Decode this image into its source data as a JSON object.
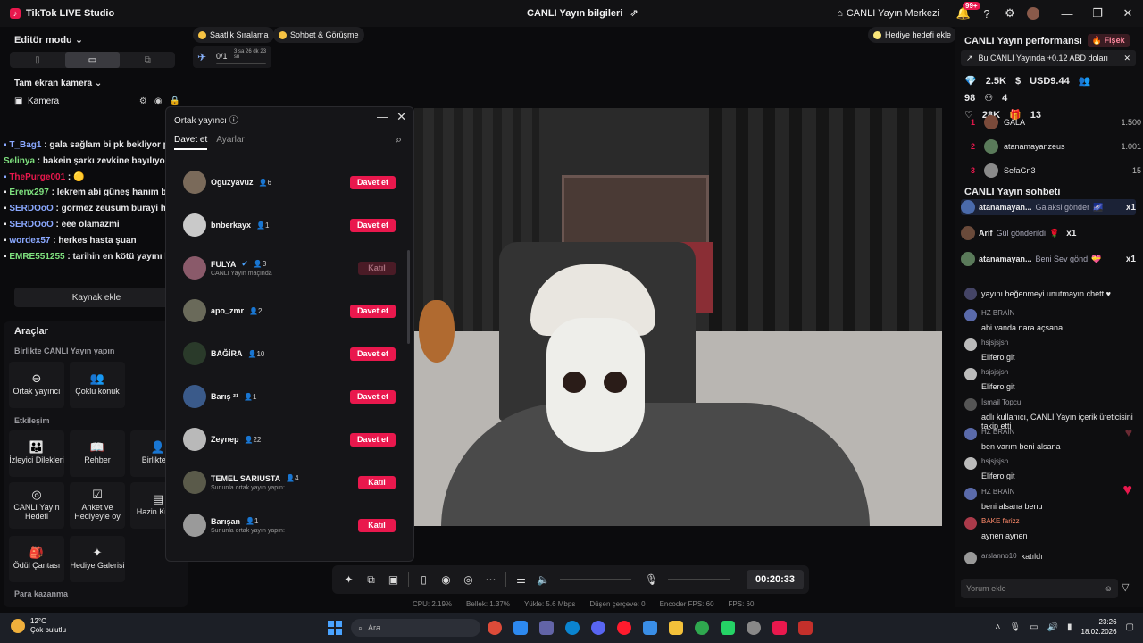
{
  "titlebar": {
    "app_name": "TikTok LIVE Studio",
    "center_title": "CANLI Yayın bilgileri",
    "live_center": "CANLI Yayın Merkezi",
    "notif_badge": "99+"
  },
  "left": {
    "editor_mode": "Editör modu",
    "camera_section": "Tam ekran kamera",
    "camera_label": "Kamera",
    "chat_lines": [
      {
        "user": "T_Bag1",
        "text": " : gala sağlam bi pk bekliyor pusuda",
        "color": "#8aa8ff"
      },
      {
        "user": "Selinya",
        "text": " : bakein şarkı zevkine bayılıyorum",
        "color": "#7ee07e"
      },
      {
        "user": "ThePurge001",
        "text": " : ",
        "color": "#e9184d"
      },
      {
        "user": "Erenx297",
        "text": " : lekrem abi güneş hanım bugün yayın açmıcak mı",
        "color": "#7ee07e"
      },
      {
        "user": "SERDOoO",
        "text": " : gormez zeusum burayi hu",
        "color": "#8aa8ff"
      },
      {
        "user": "SERDOoO",
        "text": " : eee olamazmi",
        "color": "#8aa8ff"
      },
      {
        "user": "wordex57",
        "text": " : herkes hasta şuan",
        "color": "#8aa8ff"
      },
      {
        "user": "EMRE551255",
        "text": " : tarihin en kötü yayını harbi",
        "color": "#7ee07e"
      }
    ],
    "add_source": "Kaynak ekle",
    "tools_title": "Araçlar",
    "together_title": "Birlikte CANLI Yayın yapın",
    "tools_together": [
      {
        "label": "Ortak yayıncı",
        "icon": "link-icon"
      },
      {
        "label": "Çoklu konuk",
        "icon": "users-icon"
      }
    ],
    "interaction_title": "Etkileşim",
    "tools_interaction": [
      {
        "label": "İzleyici Dilekleri",
        "icon": "people-icon"
      },
      {
        "label": "Rehber",
        "icon": "book-icon"
      },
      {
        "label": "Birlikte O",
        "icon": "person-icon"
      },
      {
        "label": "CANLI Yayın Hedefi",
        "icon": "target-icon"
      },
      {
        "label": "Anket ve Hediyeyle oy",
        "icon": "poll-icon"
      },
      {
        "label": "Hazin Kutus",
        "icon": "chest-icon"
      },
      {
        "label": "Ödül Çantası",
        "icon": "bag-icon"
      },
      {
        "label": "Hediye Galerisi",
        "icon": "gallery-icon"
      }
    ],
    "earn_title": "Para kazanma"
  },
  "top": {
    "pill_ranking": "Saatlik Sıralama",
    "pill_chat": "Sohbet & Görüşme",
    "gift_goal": "Hediye hedefi ekle",
    "goal_progress": "0/1",
    "goal_time": "3 sa 26 dk 23 sn"
  },
  "modal": {
    "title": "Ortak yayıncı",
    "tab_invite": "Davet et",
    "tab_settings": "Ayarlar",
    "rows": [
      {
        "name": "Oguzyavuz",
        "count": "6",
        "sub": "",
        "btn": "Davet et",
        "disabled": false
      },
      {
        "name": "bnberkayx",
        "count": "1",
        "sub": "",
        "btn": "Davet et",
        "disabled": false
      },
      {
        "name": "FULYA",
        "count": "3",
        "sub": "CANLI Yayın maçında",
        "btn": "Katıl",
        "disabled": true
      },
      {
        "name": "apo_zmr",
        "count": "2",
        "sub": "",
        "btn": "Davet et",
        "disabled": false
      },
      {
        "name": "BAĞİRA",
        "count": "10",
        "sub": "",
        "btn": "Davet et",
        "disabled": false
      },
      {
        "name": "Barış ²¹",
        "count": "1",
        "sub": "",
        "btn": "Davet et",
        "disabled": false
      },
      {
        "name": "Zeynep",
        "count": "22",
        "sub": "",
        "btn": "Davet et",
        "disabled": false
      },
      {
        "name": "TEMEL SARIUSTA",
        "count": "4",
        "sub": "Şununla ortak yayın yapın:",
        "btn": "Katıl",
        "disabled": false
      },
      {
        "name": "Barışan",
        "count": "1",
        "sub": "Şununla ortak yayın yapın:",
        "btn": "Katıl",
        "disabled": false
      }
    ]
  },
  "controls": {
    "timer": "00:20:33",
    "stats": [
      "CPU: 2.19%",
      "Bellek: 1.37%",
      "Yükle: 5.6 Mbps",
      "Düşen çerçeve: 0",
      "Encoder FPS: 60",
      "FPS: 60"
    ]
  },
  "right": {
    "perf_title": "CANLI Yayın performansı",
    "perf_badge": "Fişek",
    "earnings": "Bu CANLI Yayında +0.12 ABD doları",
    "metrics": [
      "2.5K",
      "USD9.44",
      "98",
      "4",
      "28K",
      "13"
    ],
    "ranking": [
      {
        "rank": "1",
        "name": "GALA",
        "value": "1.500"
      },
      {
        "rank": "2",
        "name": "atanamayanzeus",
        "value": "1.001"
      },
      {
        "rank": "3",
        "name": "SefaGn3",
        "value": "15"
      }
    ],
    "chat_title": "CANLI Yayın sohbeti",
    "pinned": [
      {
        "user": "atanamayan...",
        "text": "Galaksi gönder",
        "mult": "x1"
      },
      {
        "user": "Arif",
        "text": "Gül gönderildi",
        "mult": "x1"
      },
      {
        "user": "atanamayan...",
        "text": "Beni Sev gönd",
        "mult": "x1"
      }
    ],
    "messages": [
      {
        "user": "",
        "text": "yayını beğenmeyi unutmayın chett ♥"
      },
      {
        "user": "HZ BRAİN",
        "text": "abi vanda nara açsana"
      },
      {
        "user": "hsjsjsjsh",
        "text": "Elifero git"
      },
      {
        "user": "hsjsjsjsh",
        "text": "Elifero git"
      },
      {
        "user": "İsmail Topcu",
        "text": "adlı kullanıcı, CANLI Yayın içerik üreticisini takip etti"
      },
      {
        "user": "HZ BRAİN",
        "text": "ben varım beni alsana"
      },
      {
        "user": "hsjsjsjsh",
        "text": "Elifero git"
      },
      {
        "user": "HZ BRAİN",
        "text": "beni alsana benu"
      },
      {
        "user": "BAKE farizz",
        "text": "aynen aynen"
      },
      {
        "user": "arslanno10",
        "text": "katıldı"
      }
    ],
    "comment_placeholder": "Yorum ekle"
  },
  "taskbar": {
    "temp": "12°C",
    "weather": "Çok bulutlu",
    "search": "Ara",
    "time": "23:26",
    "date": "18.02.2026"
  }
}
